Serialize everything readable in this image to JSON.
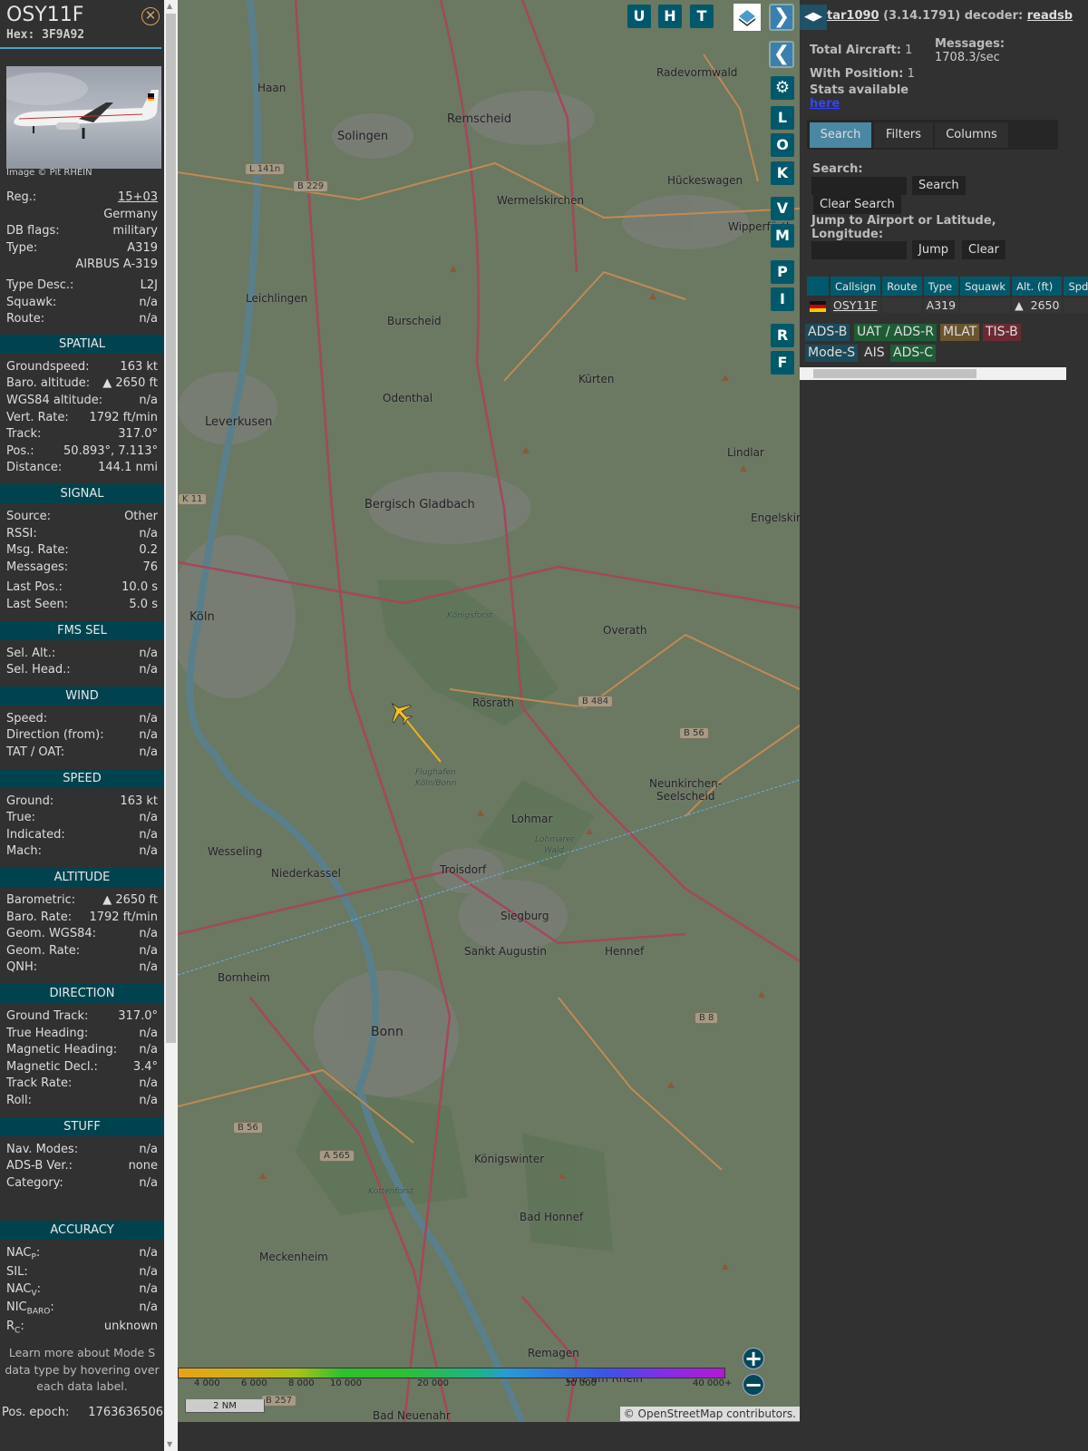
{
  "info": {
    "callsign": "OSY11F",
    "hex": "Hex: 3F9A92",
    "image_credit": "Image © Pit RHEIN",
    "top_rows": [
      {
        "label": "Reg.:",
        "value": "15+03",
        "link": true
      },
      {
        "label": "",
        "value": "Germany"
      },
      {
        "label": "DB flags:",
        "value": "military"
      },
      {
        "label": "Type:",
        "value": "A319"
      },
      {
        "label": "",
        "value": "AIRBUS A-319"
      },
      {
        "label": "Type Desc.:",
        "value": "L2J",
        "gap": true
      },
      {
        "label": "Squawk:",
        "value": "n/a"
      },
      {
        "label": "Route:",
        "value": "n/a"
      }
    ],
    "sections": [
      {
        "title": "SPATIAL",
        "rows": [
          {
            "label": "Groundspeed:",
            "value": "163 kt"
          },
          {
            "label": "Baro. altitude:",
            "value": "▲ 2650 ft"
          },
          {
            "label": "WGS84 altitude:",
            "value": "n/a"
          },
          {
            "label": "Vert. Rate:",
            "value": "1792 ft/min"
          },
          {
            "label": "Track:",
            "value": "317.0°"
          },
          {
            "label": "Pos.:",
            "value": "50.893°, 7.113°"
          },
          {
            "label": "Distance:",
            "value": "144.1 nmi"
          }
        ]
      },
      {
        "title": "SIGNAL",
        "rows": [
          {
            "label": "Source:",
            "value": "Other"
          },
          {
            "label": "RSSI:",
            "value": "n/a"
          },
          {
            "label": "Msg. Rate:",
            "value": "0.2"
          },
          {
            "label": "Messages:",
            "value": "76"
          },
          {
            "label": "Last Pos.:",
            "value": "10.0 s",
            "gap": true
          },
          {
            "label": "Last Seen:",
            "value": "5.0 s"
          }
        ]
      },
      {
        "title": "FMS SEL",
        "rows": [
          {
            "label": "Sel. Alt.:",
            "value": "n/a"
          },
          {
            "label": "Sel. Head.:",
            "value": "n/a"
          }
        ]
      },
      {
        "title": "WIND",
        "rows": [
          {
            "label": "Speed:",
            "value": "n/a"
          },
          {
            "label": "Direction (from):",
            "value": "n/a"
          },
          {
            "label": "TAT / OAT:",
            "value": "n/a"
          }
        ]
      },
      {
        "title": "SPEED",
        "rows": [
          {
            "label": "Ground:",
            "value": "163 kt"
          },
          {
            "label": "True:",
            "value": "n/a"
          },
          {
            "label": "Indicated:",
            "value": "n/a"
          },
          {
            "label": "Mach:",
            "value": "n/a"
          }
        ]
      },
      {
        "title": "ALTITUDE",
        "rows": [
          {
            "label": "Barometric:",
            "value": "▲ 2650 ft"
          },
          {
            "label": "Baro. Rate:",
            "value": "1792 ft/min"
          },
          {
            "label": "Geom. WGS84:",
            "value": "n/a"
          },
          {
            "label": "Geom. Rate:",
            "value": "n/a"
          },
          {
            "label": "QNH:",
            "value": "n/a"
          }
        ]
      },
      {
        "title": "DIRECTION",
        "rows": [
          {
            "label": "Ground Track:",
            "value": "317.0°"
          },
          {
            "label": "True Heading:",
            "value": "n/a"
          },
          {
            "label": "Magnetic Heading:",
            "value": "n/a"
          },
          {
            "label": "Magnetic Decl.:",
            "value": "3.4°"
          },
          {
            "label": "Track Rate:",
            "value": "n/a"
          },
          {
            "label": "Roll:",
            "value": "n/a"
          }
        ]
      },
      {
        "title": "STUFF",
        "rows": [
          {
            "label": "Nav. Modes:",
            "value": "n/a"
          },
          {
            "label": "ADS-B Ver.:",
            "value": "none"
          },
          {
            "label": "Category:",
            "value": "n/a"
          }
        ],
        "after_gap": true
      },
      {
        "title": "ACCURACY",
        "rows": [
          {
            "label": "NAC",
            "sub": "P",
            "value": "n/a"
          },
          {
            "label": "SIL",
            "value": "n/a"
          },
          {
            "label": "NAC",
            "sub": "V",
            "value": "n/a"
          },
          {
            "label": "NIC",
            "sub": "BARO",
            "value": "n/a"
          },
          {
            "label": "R",
            "sub": "C",
            "value": "unknown"
          }
        ]
      }
    ],
    "footer_text": "Learn more about Mode S data type by hovering over each data label.",
    "pos_epoch_label": "Pos. epoch:",
    "pos_epoch_value": "1763636506"
  },
  "map": {
    "top_buttons": [
      "U",
      "H",
      "T"
    ],
    "side_buttons": [
      "L",
      "O",
      "K",
      "V",
      "M",
      "P",
      "I",
      "R",
      "F"
    ],
    "labels": [
      "Haan",
      "Solingen",
      "Remscheid",
      "Radevormwald",
      "Wermelskirchen",
      "Hückeswagen",
      "Wipperfürth",
      "Leichlingen",
      "Burscheid",
      "Leverkusen",
      "Odenthal",
      "Kürten",
      "Lindlar",
      "Bergisch Gladbach",
      "Köln",
      "Overath",
      "Rösrath",
      "Engelskirch",
      "Neunkirchen-",
      "Seelscheid",
      "Lohmar",
      "Wesseling",
      "Niederkassel",
      "Troisdorf",
      "Siegburg",
      "Sankt Augustin",
      "Hennef",
      "Bornheim",
      "Bonn",
      "Königswinter",
      "Bad Honnef",
      "Meckenheim",
      "Remagen",
      "Bad Neuenahr",
      "Linz am Rhein",
      "Flughafen",
      "Köln/Bonn",
      "Königsforst",
      "Lohmarer",
      "Wald",
      "Kottenforst"
    ],
    "shields": [
      "L 141n",
      "B 229",
      "B 484",
      "B 56",
      "B 8",
      "B 56",
      "A 565",
      "B 257",
      "K 11"
    ],
    "color_scale": [
      "4 000",
      "6 000",
      "8 000",
      "10 000",
      "20 000",
      "30 000",
      "40 000+"
    ],
    "scale_label": "2 NM",
    "attribution": "© OpenStreetMap contributors.",
    "zoom_in": "+",
    "zoom_out": "−"
  },
  "panel": {
    "app_name": "tar1090",
    "version": " (3.14.1791) decoder: ",
    "decoder": "readsb",
    "total_aircraft_label": "Total Aircraft:",
    "total_aircraft": " 1",
    "with_position_label": "With Position:",
    "with_position": " 1",
    "messages_label": "Messages:",
    "messages_rate": "1708.3/sec",
    "stats_text": "Stats available",
    "stats_link": "here",
    "tabs": [
      "Search",
      "Filters",
      "Columns"
    ],
    "search_label": "Search:",
    "search_button": "Search",
    "clear_search_button": "Clear Search",
    "jump_label": "Jump to Airport or Latitude, Longitude:",
    "jump_button": "Jump",
    "clear_button": "Clear",
    "table": {
      "columns": [
        "",
        "Callsign",
        "Route",
        "Type",
        "Squawk",
        "Alt. (ft)",
        "Spd"
      ],
      "rows": [
        {
          "callsign": "OSY11F",
          "route": "",
          "type": "A319",
          "squawk": "",
          "alt": "▲  2650",
          "spd": ""
        }
      ]
    },
    "legend": [
      {
        "label": "ADS-B",
        "color": "#1d4a5a"
      },
      {
        "label": "UAT / ADS-R",
        "color": "#1f5c36"
      },
      {
        "label": "MLAT",
        "color": "#6b5530"
      },
      {
        "label": "TIS-B",
        "color": "#6b2a32"
      },
      {
        "label": "Mode-S",
        "color": "#1d4a5a"
      },
      {
        "label": "AIS",
        "color": "#333333"
      },
      {
        "label": "ADS-C",
        "color": "#1f5c36"
      }
    ]
  }
}
